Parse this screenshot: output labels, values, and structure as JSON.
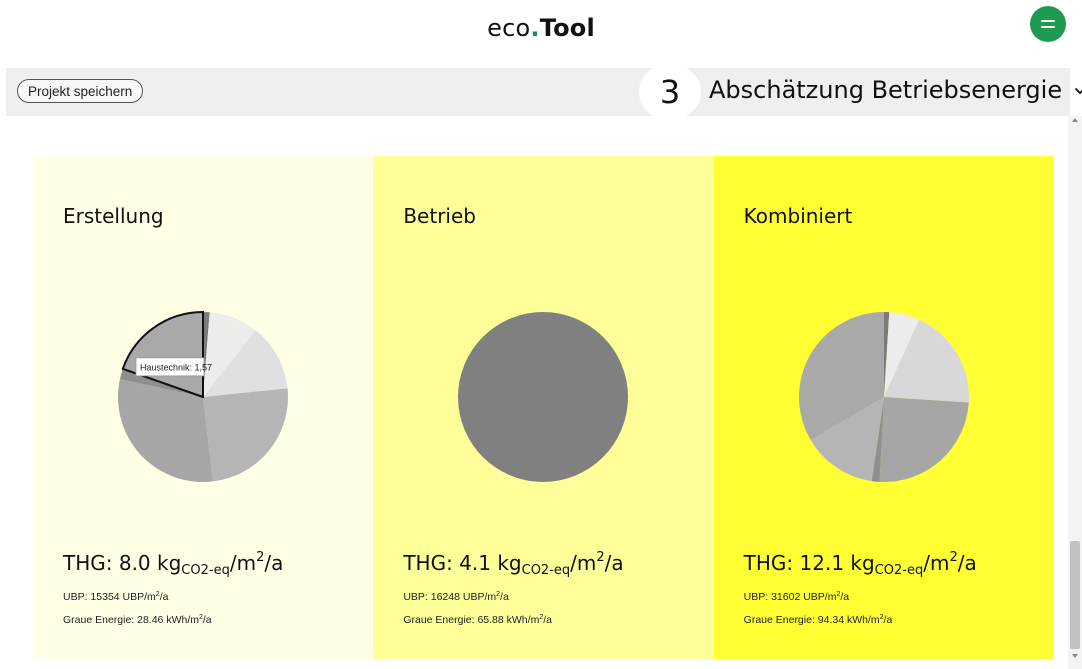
{
  "header": {
    "brand_prefix": "eco",
    "brand_dot": ".",
    "brand_suffix": "Tool",
    "menu_icon": "menu-lines-icon",
    "accent_color": "#1f9a52"
  },
  "toolbar": {
    "save_label": "Projekt speichern",
    "step_number": "3",
    "step_title": "Abschätzung Betriebsenergie"
  },
  "panels": [
    {
      "title": "Erstellung",
      "background": "#ffffe6",
      "thg_prefix": "THG: 8.0 kg",
      "thg_sub": "CO2-eq",
      "thg_unit": "/m",
      "thg_sup": "2",
      "thg_suffix": "/a",
      "ubp_text": "UBP: 15354 UBP/m",
      "ubp_sup": "2",
      "ubp_suffix": "/a",
      "graue_text": "Graue Energie: 28.46 kWh/m",
      "graue_sup": "2",
      "graue_suffix": "/a",
      "tooltip": "Haustechnik: 1,57",
      "pie": [
        {
          "value": 0.1,
          "color": "#7a7a7a"
        },
        {
          "value": 0.75,
          "color": "#ececea"
        },
        {
          "value": 1.02,
          "color": "#e0e0e0"
        },
        {
          "value": 1.98,
          "color": "#b5b5b5"
        },
        {
          "value": 2.42,
          "color": "#a6a6a6"
        },
        {
          "value": 0.16,
          "color": "#8f8f8f"
        },
        {
          "value": 1.57,
          "color": "#a9a9a9",
          "highlight": true
        }
      ]
    },
    {
      "title": "Betrieb",
      "background": "#ffff99",
      "thg_prefix": "THG: 4.1 kg",
      "thg_sub": "CO2-eq",
      "thg_unit": "/m",
      "thg_sup": "2",
      "thg_suffix": "/a",
      "ubp_text": "UBP: 16248 UBP/m",
      "ubp_sup": "2",
      "ubp_suffix": "/a",
      "graue_text": "Graue Energie: 65.88 kWh/m",
      "graue_sup": "2",
      "graue_suffix": "/a",
      "pie": [
        {
          "value": 4.1,
          "color": "#808080"
        }
      ]
    },
    {
      "title": "Kombiniert",
      "background": "#ffff33",
      "thg_prefix": "THG: 12.1 kg",
      "thg_sub": "CO2-eq",
      "thg_unit": "/m",
      "thg_sup": "2",
      "thg_suffix": "/a",
      "ubp_text": "UBP: 31602 UBP/m",
      "ubp_sup": "2",
      "ubp_suffix": "/a",
      "graue_text": "Graue Energie: 94.34 kWh/m",
      "graue_sup": "2",
      "graue_suffix": "/a",
      "pie": [
        {
          "value": 0.12,
          "color": "#7a7a7a"
        },
        {
          "value": 0.7,
          "color": "#ececea"
        },
        {
          "value": 2.33,
          "color": "#d8d8d8"
        },
        {
          "value": 3.0,
          "color": "#a6a6a6"
        },
        {
          "value": 0.18,
          "color": "#8f8f8f"
        },
        {
          "value": 1.72,
          "color": "#b5b5b5"
        },
        {
          "value": 4.05,
          "color": "#a9a9a9"
        }
      ]
    }
  ],
  "chart_data": [
    {
      "type": "pie",
      "title": "Erstellung",
      "labels": [
        "",
        "",
        "",
        "",
        "",
        "",
        "Haustechnik"
      ],
      "values": [
        0.1,
        0.75,
        1.02,
        1.98,
        2.42,
        0.16,
        1.57
      ],
      "annotations": [
        "Haustechnik: 1,57"
      ]
    },
    {
      "type": "pie",
      "title": "Betrieb",
      "values": [
        4.1
      ]
    },
    {
      "type": "pie",
      "title": "Kombiniert",
      "values": [
        0.12,
        0.7,
        2.33,
        3.0,
        0.18,
        1.72,
        4.05
      ]
    }
  ]
}
